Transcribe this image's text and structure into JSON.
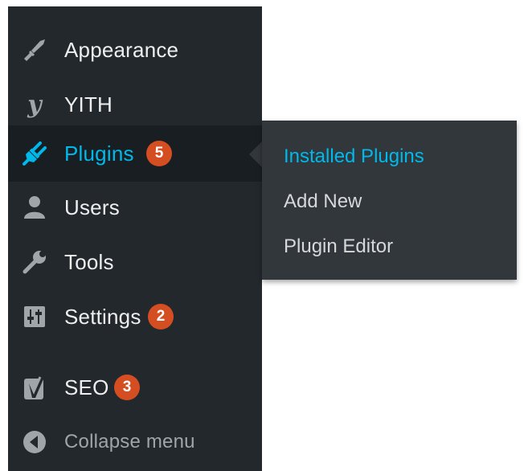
{
  "menu": {
    "items": [
      {
        "label": "Appearance",
        "icon": "paintbrush-icon"
      },
      {
        "label": "YITH",
        "icon": "yith-icon"
      },
      {
        "label": "Plugins",
        "icon": "plug-icon",
        "badge": "5",
        "current": true
      },
      {
        "label": "Users",
        "icon": "user-icon"
      },
      {
        "label": "Tools",
        "icon": "wrench-icon"
      },
      {
        "label": "Settings",
        "icon": "settings-sliders-icon",
        "badge": "2"
      },
      {
        "label": "SEO",
        "icon": "yoast-icon",
        "badge": "3"
      }
    ],
    "collapse_label": "Collapse menu"
  },
  "submenu": {
    "items": [
      {
        "label": "Installed Plugins",
        "current": true
      },
      {
        "label": "Add New"
      },
      {
        "label": "Plugin Editor"
      }
    ]
  },
  "colors": {
    "sidebar_bg": "#23282d",
    "current_bg": "#191e23",
    "flyout_bg": "#32373c",
    "accent": "#00b9eb",
    "badge": "#d54e21",
    "text": "#eeeeee"
  }
}
